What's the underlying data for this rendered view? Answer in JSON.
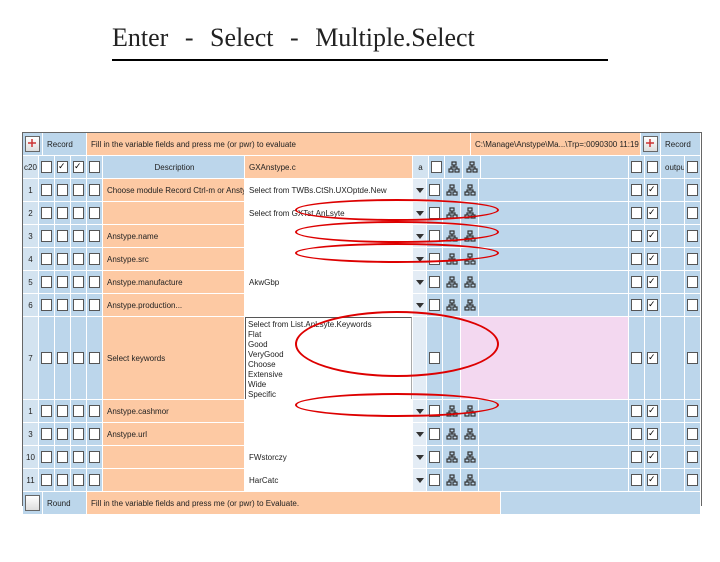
{
  "title": {
    "a": "Enter",
    "b": "Select",
    "c": "Multiple.Select"
  },
  "header": {
    "record_l": "Record",
    "instr": "Fill in the variable fields and press me (or pwr) to evaluate",
    "path": "C:\\Manage\\Anstype\\Ma...\\Trp=:0090300 11:19",
    "record_r": "Record"
  },
  "row0": {
    "col_desc": "Description",
    "col_val": "GXAnstype.c",
    "out": "output"
  },
  "rows": [
    {
      "n": "1",
      "desc": "Choose module Record Ctrl-m or Anstype",
      "val": "Select from TWBs.CtSh.UXOptde.New"
    },
    {
      "n": "2",
      "desc": "",
      "val": "Select from GXTst.AnLsyte"
    },
    {
      "n": "3",
      "desc": "Anstype.name",
      "val": ""
    },
    {
      "n": "4",
      "desc": "Anstype.src",
      "val": ""
    },
    {
      "n": "5",
      "desc": "Anstype.manufacture",
      "val": "AkwGbp"
    },
    {
      "n": "6",
      "desc": "Anstype.production...",
      "val": ""
    }
  ],
  "multi": {
    "n": "7",
    "desc": "Select keywords",
    "header": "Select from List.AnLsyte.Keywords",
    "items": [
      "Flat",
      "Good",
      "VeryGood",
      "Choose",
      "Extensive",
      "Wide",
      "Specific"
    ]
  },
  "rows2": [
    {
      "n": "1",
      "desc": "Anstype.cashmor",
      "val": ""
    },
    {
      "n": "3",
      "desc": "Anstype.url",
      "val": ""
    },
    {
      "n": "10",
      "desc": "",
      "val": "FWstorczy"
    },
    {
      "n": "11",
      "desc": "",
      "val": "HarCatc"
    }
  ],
  "footer": {
    "round": "Round",
    "instr": "Fill in the variable fields and press me (or pwr) to Evaluate."
  }
}
